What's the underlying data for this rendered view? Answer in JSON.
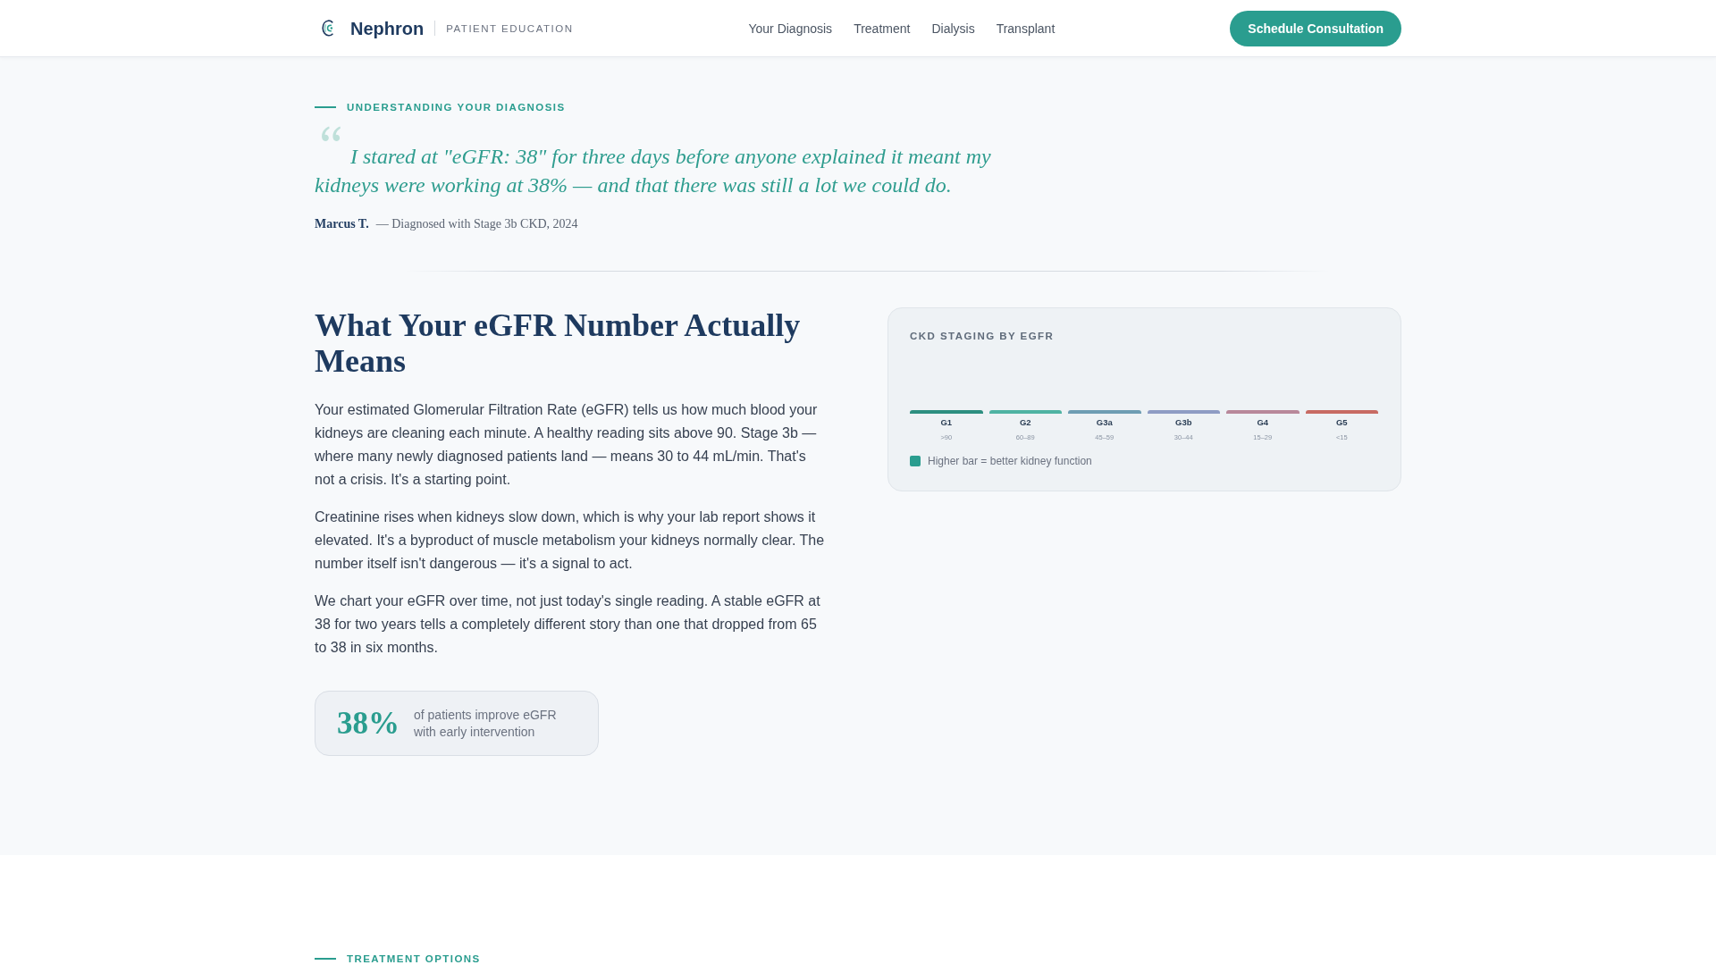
{
  "header": {
    "brand": "Nephron",
    "tagline": "PATIENT EDUCATION",
    "nav": [
      {
        "label": "Your Diagnosis"
      },
      {
        "label": "Treatment"
      },
      {
        "label": "Dialysis"
      },
      {
        "label": "Transplant"
      }
    ],
    "cta": "Schedule Consultation"
  },
  "hero": {
    "eyebrow": "UNDERSTANDING YOUR DIAGNOSIS",
    "quote": "I stared at \"eGFR: 38\" for three days before anyone explained it meant my kidneys were working at 38% — and that there was still a lot we could do.",
    "author": "Marcus T.",
    "author_note": "— Diagnosed with Stage 3b CKD, 2024"
  },
  "explainer": {
    "heading": "What Your eGFR Number Actually Means",
    "paragraphs": [
      "Your estimated Glomerular Filtration Rate (eGFR) tells us how much blood your kidneys are cleaning each minute. A healthy reading sits above 90. Stage 3b — where many newly diagnosed patients land — means 30 to 44 mL/min. That's not a crisis. It's a starting point.",
      "Creatinine rises when kidneys slow down, which is why your lab report shows it elevated. It's a byproduct of muscle metabolism your kidneys normally clear. The number itself isn't dangerous — it's a signal to act.",
      "We chart your eGFR over time, not just today's single reading. A stable eGFR at 38 for two years tells a completely different story than one that dropped from 65 to 38 in six months."
    ],
    "stat": {
      "value": "38%",
      "text": "of patients improve eGFR with early intervention"
    }
  },
  "staging_card": {
    "title": "CKD STAGING BY EGFR",
    "stages": [
      {
        "label": "G1",
        "range": ">90",
        "color": "#2d8f80"
      },
      {
        "label": "G2",
        "range": "60–89",
        "color": "#4fb3a3"
      },
      {
        "label": "G3a",
        "range": "45–59",
        "color": "#6e9db3"
      },
      {
        "label": "G3b",
        "range": "30–44",
        "color": "#8e9cc4"
      },
      {
        "label": "G4",
        "range": "15–29",
        "color": "#b8889a"
      },
      {
        "label": "G5",
        "range": "<15",
        "color": "#c76b63"
      }
    ],
    "legend": "Higher bar = better kidney function"
  },
  "next_section": {
    "eyebrow": "TREATMENT OPTIONS"
  }
}
